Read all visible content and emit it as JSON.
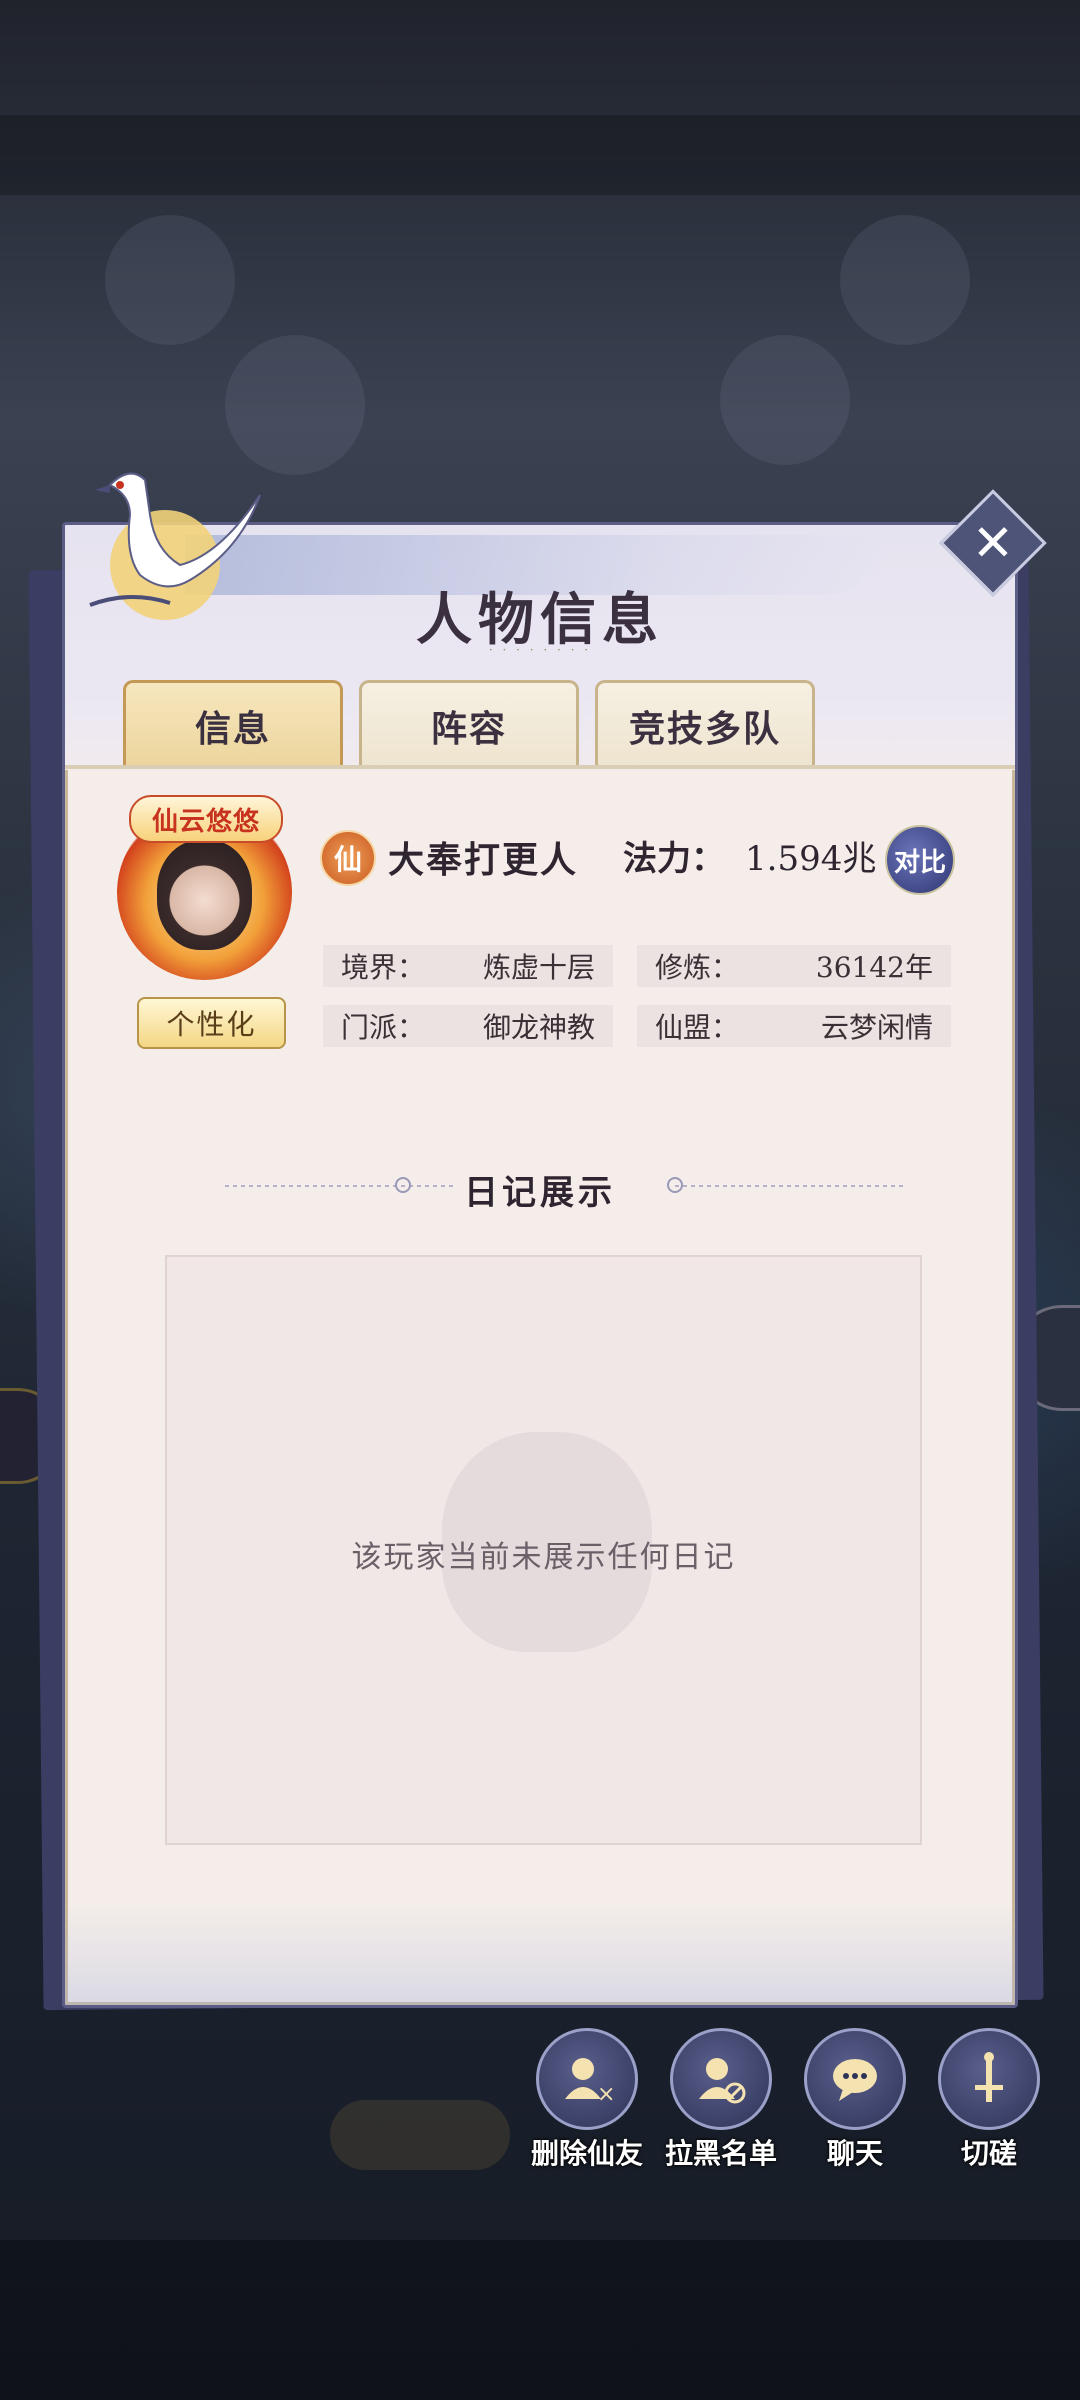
{
  "dialog": {
    "title": "人物信息",
    "tabs": [
      {
        "label": "信息",
        "active": true
      },
      {
        "label": "阵容",
        "active": false
      },
      {
        "label": "竞技多队",
        "active": false
      }
    ]
  },
  "player": {
    "avatar_badge": "仙云悠悠",
    "personalize_label": "个性化",
    "rank_badge": "仙",
    "name": "大奉打更人",
    "power_label": "法力：",
    "power_value": "1.594兆",
    "compare_label": "对比",
    "stats": [
      {
        "label": "境界：",
        "value": "炼虚十层"
      },
      {
        "label": "修炼：",
        "value": "36142年"
      },
      {
        "label": "门派：",
        "value": "御龙神教"
      },
      {
        "label": "仙盟：",
        "value": "云梦闲情"
      }
    ]
  },
  "diary": {
    "title": "日记展示",
    "empty_text": "该玩家当前未展示任何日记"
  },
  "actions": [
    {
      "label": "删除仙友",
      "icon": "remove-friend-icon"
    },
    {
      "label": "拉黑名单",
      "icon": "block-user-icon"
    },
    {
      "label": "聊天",
      "icon": "chat-icon"
    },
    {
      "label": "切磋",
      "icon": "sword-icon"
    }
  ],
  "colors": {
    "panel_bg": "#f4ede9",
    "panel_border": "#5b5d86",
    "tab_active": "#ecd59c",
    "accent_gold": "#c29a55",
    "action_button": "#2e3358"
  }
}
